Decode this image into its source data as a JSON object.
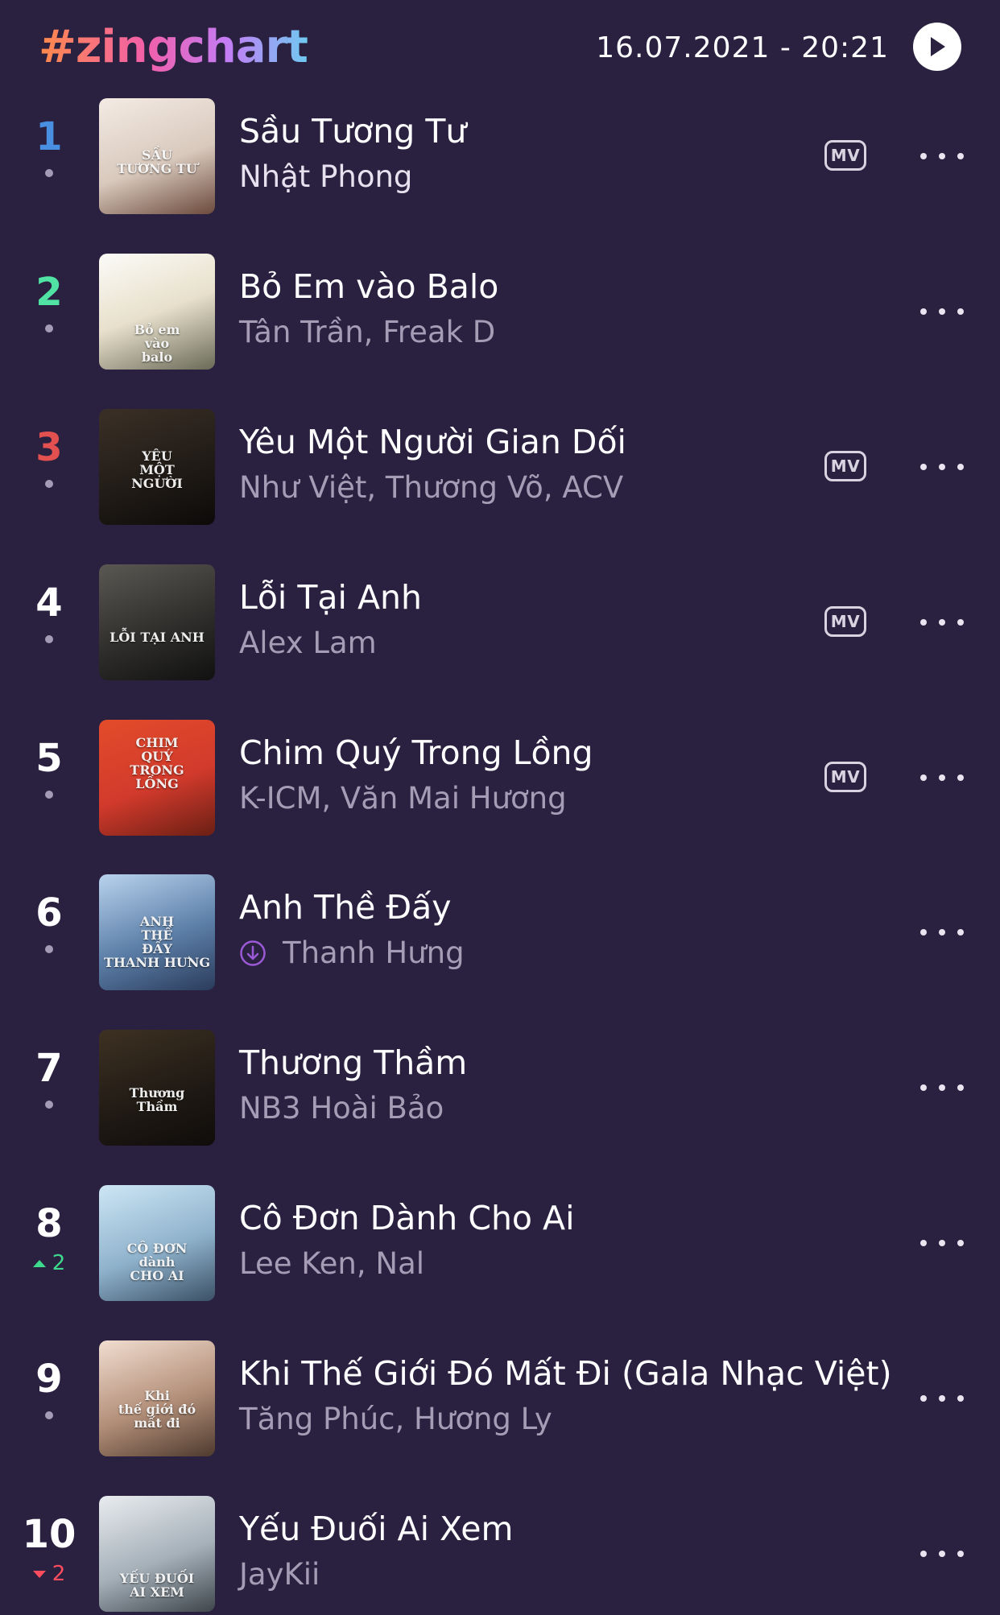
{
  "header": {
    "brand": "#zingchart",
    "datetime": "16.07.2021 - 20:21",
    "play_icon": "play-icon"
  },
  "colors": {
    "background": "#2a2140",
    "rank1": "#4a90e2",
    "rank2": "#50e3a4",
    "rank3": "#e35050",
    "up": "#3fd98e",
    "down": "#ff4d5e",
    "secondary_text": "#a59cb6"
  },
  "songs": [
    {
      "rank": "1",
      "title": "Sầu Tương Tư",
      "artist": "Nhật Phong",
      "mv": "MV",
      "change": "",
      "cover_text": "SẦU\nTƯƠNG TƯ"
    },
    {
      "rank": "2",
      "title": "Bỏ Em vào Balo",
      "artist": "Tân Trần, Freak D",
      "mv": "",
      "change": "",
      "cover_text": "Bỏ em\nvào\nbalo"
    },
    {
      "rank": "3",
      "title": "Yêu Một Người Gian Dối",
      "artist": "Như Việt, Thương Võ, ACV",
      "mv": "MV",
      "change": "",
      "cover_text": "YÊU\nMỘT\nNGƯỜI"
    },
    {
      "rank": "4",
      "title": "Lỗi Tại Anh",
      "artist": "Alex Lam",
      "mv": "MV",
      "change": "",
      "cover_text": "LỖI TẠI ANH"
    },
    {
      "rank": "5",
      "title": "Chim Quý Trong Lồng",
      "artist": "K-ICM, Văn Mai Hương",
      "mv": "MV",
      "change": "",
      "cover_text": "CHIM\nQUÝ\nTRONG\nLỒNG"
    },
    {
      "rank": "6",
      "title": "Anh Thề Đấy",
      "artist": "Thanh Hưng",
      "mv": "",
      "change": "",
      "cover_text": "ANH\nTHỀ\nĐẤY\nTHANH HƯNG",
      "download": true
    },
    {
      "rank": "7",
      "title": "Thương Thầm",
      "artist": "NB3 Hoài Bảo",
      "mv": "",
      "change": "",
      "cover_text": "Thương\nThầm"
    },
    {
      "rank": "8",
      "title": "Cô Đơn Dành Cho Ai",
      "artist": "Lee Ken, Nal",
      "mv": "",
      "change": "2",
      "direction": "up",
      "cover_text": "CÔ ĐƠN\ndành\nCHO AI"
    },
    {
      "rank": "9",
      "title": "Khi Thế Giới Đó Mất Đi (Gala Nhạc Việt)",
      "artist": "Tăng Phúc, Hương Ly",
      "mv": "",
      "change": "",
      "cover_text": "Khi\nthế giới đó\nmất đi"
    },
    {
      "rank": "10",
      "title": "Yếu Đuối Ai Xem",
      "artist": "JayKii",
      "mv": "",
      "change": "2",
      "direction": "down",
      "cover_text": "YẾU ĐUỐI\nAI XEM"
    }
  ]
}
